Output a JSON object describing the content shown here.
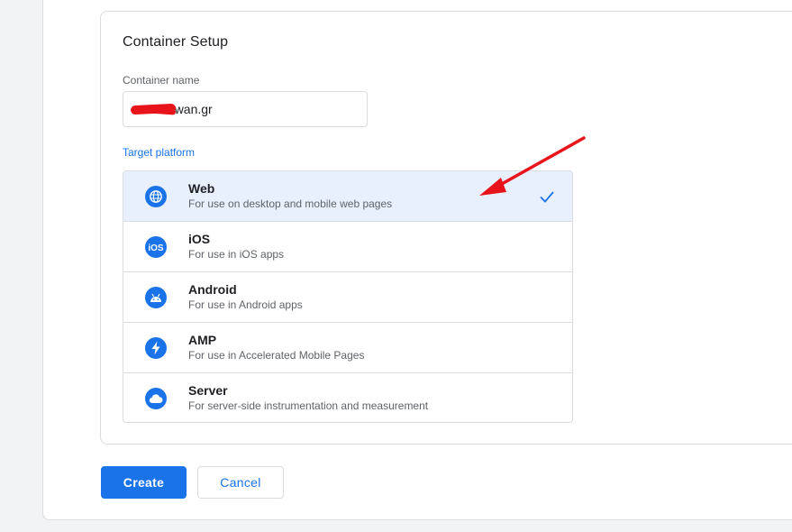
{
  "card": {
    "title": "Container Setup",
    "container_name_label": "Container name",
    "container_name_value": "wan.gr",
    "target_platform_label": "Target platform"
  },
  "platforms": [
    {
      "name": "Web",
      "description": "For use on desktop and mobile web pages",
      "icon": "globe-icon",
      "selected": true
    },
    {
      "name": "iOS",
      "description": "For use in iOS apps",
      "icon": "ios-icon",
      "selected": false
    },
    {
      "name": "Android",
      "description": "For use in Android apps",
      "icon": "android-icon",
      "selected": false
    },
    {
      "name": "AMP",
      "description": "For use in Accelerated Mobile Pages",
      "icon": "lightning-icon",
      "selected": false
    },
    {
      "name": "Server",
      "description": "For server-side instrumentation and measurement",
      "icon": "cloud-icon",
      "selected": false
    }
  ],
  "buttons": {
    "create": "Create",
    "cancel": "Cancel"
  },
  "colors": {
    "accent": "#1a73e8",
    "selected_bg": "#e8f0fe",
    "annotation": "#e8141b"
  }
}
